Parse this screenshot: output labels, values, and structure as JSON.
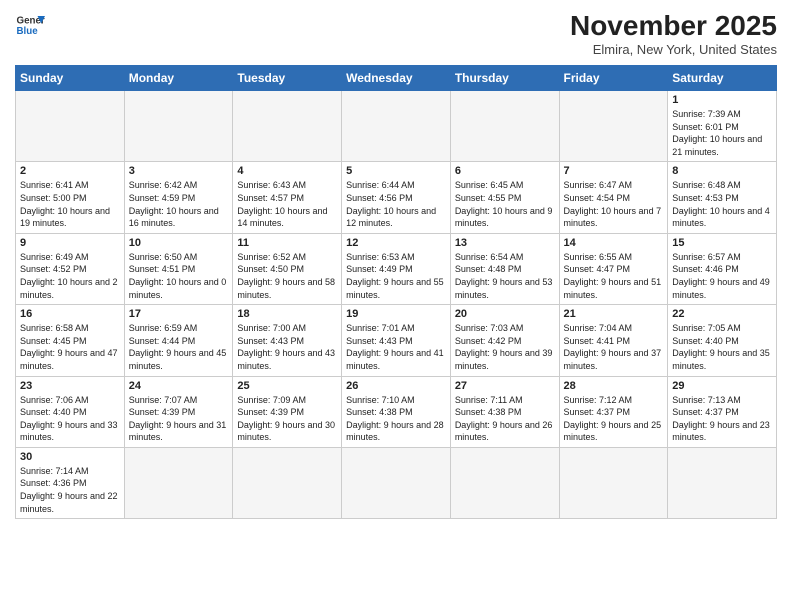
{
  "header": {
    "logo_line1": "General",
    "logo_line2": "Blue",
    "month": "November 2025",
    "location": "Elmira, New York, United States"
  },
  "days_of_week": [
    "Sunday",
    "Monday",
    "Tuesday",
    "Wednesday",
    "Thursday",
    "Friday",
    "Saturday"
  ],
  "weeks": [
    [
      {
        "day": "",
        "info": ""
      },
      {
        "day": "",
        "info": ""
      },
      {
        "day": "",
        "info": ""
      },
      {
        "day": "",
        "info": ""
      },
      {
        "day": "",
        "info": ""
      },
      {
        "day": "",
        "info": ""
      },
      {
        "day": "1",
        "info": "Sunrise: 7:39 AM\nSunset: 6:01 PM\nDaylight: 10 hours and 21 minutes."
      }
    ],
    [
      {
        "day": "2",
        "info": "Sunrise: 6:41 AM\nSunset: 5:00 PM\nDaylight: 10 hours and 19 minutes."
      },
      {
        "day": "3",
        "info": "Sunrise: 6:42 AM\nSunset: 4:59 PM\nDaylight: 10 hours and 16 minutes."
      },
      {
        "day": "4",
        "info": "Sunrise: 6:43 AM\nSunset: 4:57 PM\nDaylight: 10 hours and 14 minutes."
      },
      {
        "day": "5",
        "info": "Sunrise: 6:44 AM\nSunset: 4:56 PM\nDaylight: 10 hours and 12 minutes."
      },
      {
        "day": "6",
        "info": "Sunrise: 6:45 AM\nSunset: 4:55 PM\nDaylight: 10 hours and 9 minutes."
      },
      {
        "day": "7",
        "info": "Sunrise: 6:47 AM\nSunset: 4:54 PM\nDaylight: 10 hours and 7 minutes."
      },
      {
        "day": "8",
        "info": "Sunrise: 6:48 AM\nSunset: 4:53 PM\nDaylight: 10 hours and 4 minutes."
      }
    ],
    [
      {
        "day": "9",
        "info": "Sunrise: 6:49 AM\nSunset: 4:52 PM\nDaylight: 10 hours and 2 minutes."
      },
      {
        "day": "10",
        "info": "Sunrise: 6:50 AM\nSunset: 4:51 PM\nDaylight: 10 hours and 0 minutes."
      },
      {
        "day": "11",
        "info": "Sunrise: 6:52 AM\nSunset: 4:50 PM\nDaylight: 9 hours and 58 minutes."
      },
      {
        "day": "12",
        "info": "Sunrise: 6:53 AM\nSunset: 4:49 PM\nDaylight: 9 hours and 55 minutes."
      },
      {
        "day": "13",
        "info": "Sunrise: 6:54 AM\nSunset: 4:48 PM\nDaylight: 9 hours and 53 minutes."
      },
      {
        "day": "14",
        "info": "Sunrise: 6:55 AM\nSunset: 4:47 PM\nDaylight: 9 hours and 51 minutes."
      },
      {
        "day": "15",
        "info": "Sunrise: 6:57 AM\nSunset: 4:46 PM\nDaylight: 9 hours and 49 minutes."
      }
    ],
    [
      {
        "day": "16",
        "info": "Sunrise: 6:58 AM\nSunset: 4:45 PM\nDaylight: 9 hours and 47 minutes."
      },
      {
        "day": "17",
        "info": "Sunrise: 6:59 AM\nSunset: 4:44 PM\nDaylight: 9 hours and 45 minutes."
      },
      {
        "day": "18",
        "info": "Sunrise: 7:00 AM\nSunset: 4:43 PM\nDaylight: 9 hours and 43 minutes."
      },
      {
        "day": "19",
        "info": "Sunrise: 7:01 AM\nSunset: 4:43 PM\nDaylight: 9 hours and 41 minutes."
      },
      {
        "day": "20",
        "info": "Sunrise: 7:03 AM\nSunset: 4:42 PM\nDaylight: 9 hours and 39 minutes."
      },
      {
        "day": "21",
        "info": "Sunrise: 7:04 AM\nSunset: 4:41 PM\nDaylight: 9 hours and 37 minutes."
      },
      {
        "day": "22",
        "info": "Sunrise: 7:05 AM\nSunset: 4:40 PM\nDaylight: 9 hours and 35 minutes."
      }
    ],
    [
      {
        "day": "23",
        "info": "Sunrise: 7:06 AM\nSunset: 4:40 PM\nDaylight: 9 hours and 33 minutes."
      },
      {
        "day": "24",
        "info": "Sunrise: 7:07 AM\nSunset: 4:39 PM\nDaylight: 9 hours and 31 minutes."
      },
      {
        "day": "25",
        "info": "Sunrise: 7:09 AM\nSunset: 4:39 PM\nDaylight: 9 hours and 30 minutes."
      },
      {
        "day": "26",
        "info": "Sunrise: 7:10 AM\nSunset: 4:38 PM\nDaylight: 9 hours and 28 minutes."
      },
      {
        "day": "27",
        "info": "Sunrise: 7:11 AM\nSunset: 4:38 PM\nDaylight: 9 hours and 26 minutes."
      },
      {
        "day": "28",
        "info": "Sunrise: 7:12 AM\nSunset: 4:37 PM\nDaylight: 9 hours and 25 minutes."
      },
      {
        "day": "29",
        "info": "Sunrise: 7:13 AM\nSunset: 4:37 PM\nDaylight: 9 hours and 23 minutes."
      }
    ],
    [
      {
        "day": "30",
        "info": "Sunrise: 7:14 AM\nSunset: 4:36 PM\nDaylight: 9 hours and 22 minutes."
      },
      {
        "day": "",
        "info": ""
      },
      {
        "day": "",
        "info": ""
      },
      {
        "day": "",
        "info": ""
      },
      {
        "day": "",
        "info": ""
      },
      {
        "day": "",
        "info": ""
      },
      {
        "day": "",
        "info": ""
      }
    ]
  ]
}
